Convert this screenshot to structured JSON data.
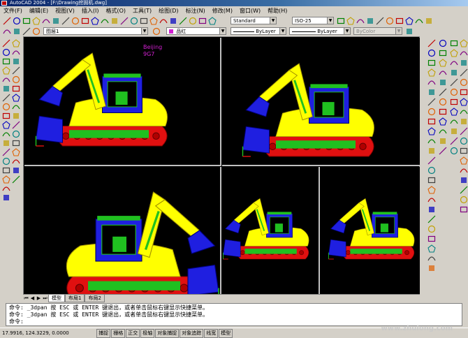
{
  "window": {
    "title": "AutoCAD 2004 - [F:\\Drawing挖掘机.dwg]"
  },
  "menubar": {
    "items": [
      "文件(F)",
      "编辑(E)",
      "视图(V)",
      "插入(I)",
      "格式(O)",
      "工具(T)",
      "绘图(D)",
      "标注(N)",
      "修改(M)",
      "窗口(W)",
      "帮助(H)"
    ]
  },
  "toolbar": {
    "text_style": "Standard",
    "dim_style": "ISO-25",
    "layer": "图层1",
    "color": "品红",
    "linetype": "ByLayer",
    "lineweight": "ByLayer",
    "plotstyle": "ByColor"
  },
  "drawing": {
    "annotation_line1": "Beijing",
    "annotation_line2": "9G7"
  },
  "layout_tabs": [
    "模型",
    "布局1",
    "布局2"
  ],
  "command": {
    "line1": "命令: _3dpan 按 ESC 或 ENTER 键退出，或者单击鼠标右键显示快捷菜单。",
    "line2": "命令: _3dpan 按 ESC 或 ENTER 键退出，或者单击鼠标右键显示快捷菜单。",
    "line3": "命令:"
  },
  "status": {
    "coordinates": "17.9916,  124.3229, 0.0000",
    "modes": [
      "捕捉",
      "栅格",
      "正交",
      "极轴",
      "对象捕捉",
      "对象追踪",
      "线宽",
      "模型"
    ]
  },
  "watermark": "www.zhulong.com",
  "colors": {
    "background": "#d4d0c8",
    "model_space": "#000000",
    "excavator_yellow": "#ffff00",
    "excavator_blue": "#1f1fe0",
    "excavator_red": "#e01010",
    "excavator_green": "#20c020",
    "annotation_magenta": "#d020d0"
  },
  "icons": {
    "left_toolbar": [
      "line-icon",
      "construction-line-icon",
      "polyline-icon",
      "polygon-icon",
      "rectangle-icon",
      "arc-icon",
      "circle-icon",
      "revision-cloud-icon",
      "spline-icon",
      "ellipse-icon",
      "ellipse-arc-icon",
      "insert-block-icon",
      "make-block-icon",
      "point-icon",
      "hatch-icon",
      "region-icon",
      "table-icon",
      "multiline-text-icon"
    ],
    "modify_toolbar": [
      "erase-icon",
      "copy-icon",
      "mirror-icon",
      "offset-icon",
      "array-icon",
      "move-icon",
      "rotate-icon",
      "scale-icon",
      "stretch-icon",
      "trim-icon",
      "extend-icon",
      "break-icon",
      "join-icon",
      "chamfer-icon",
      "fillet-icon",
      "explode-icon"
    ]
  }
}
